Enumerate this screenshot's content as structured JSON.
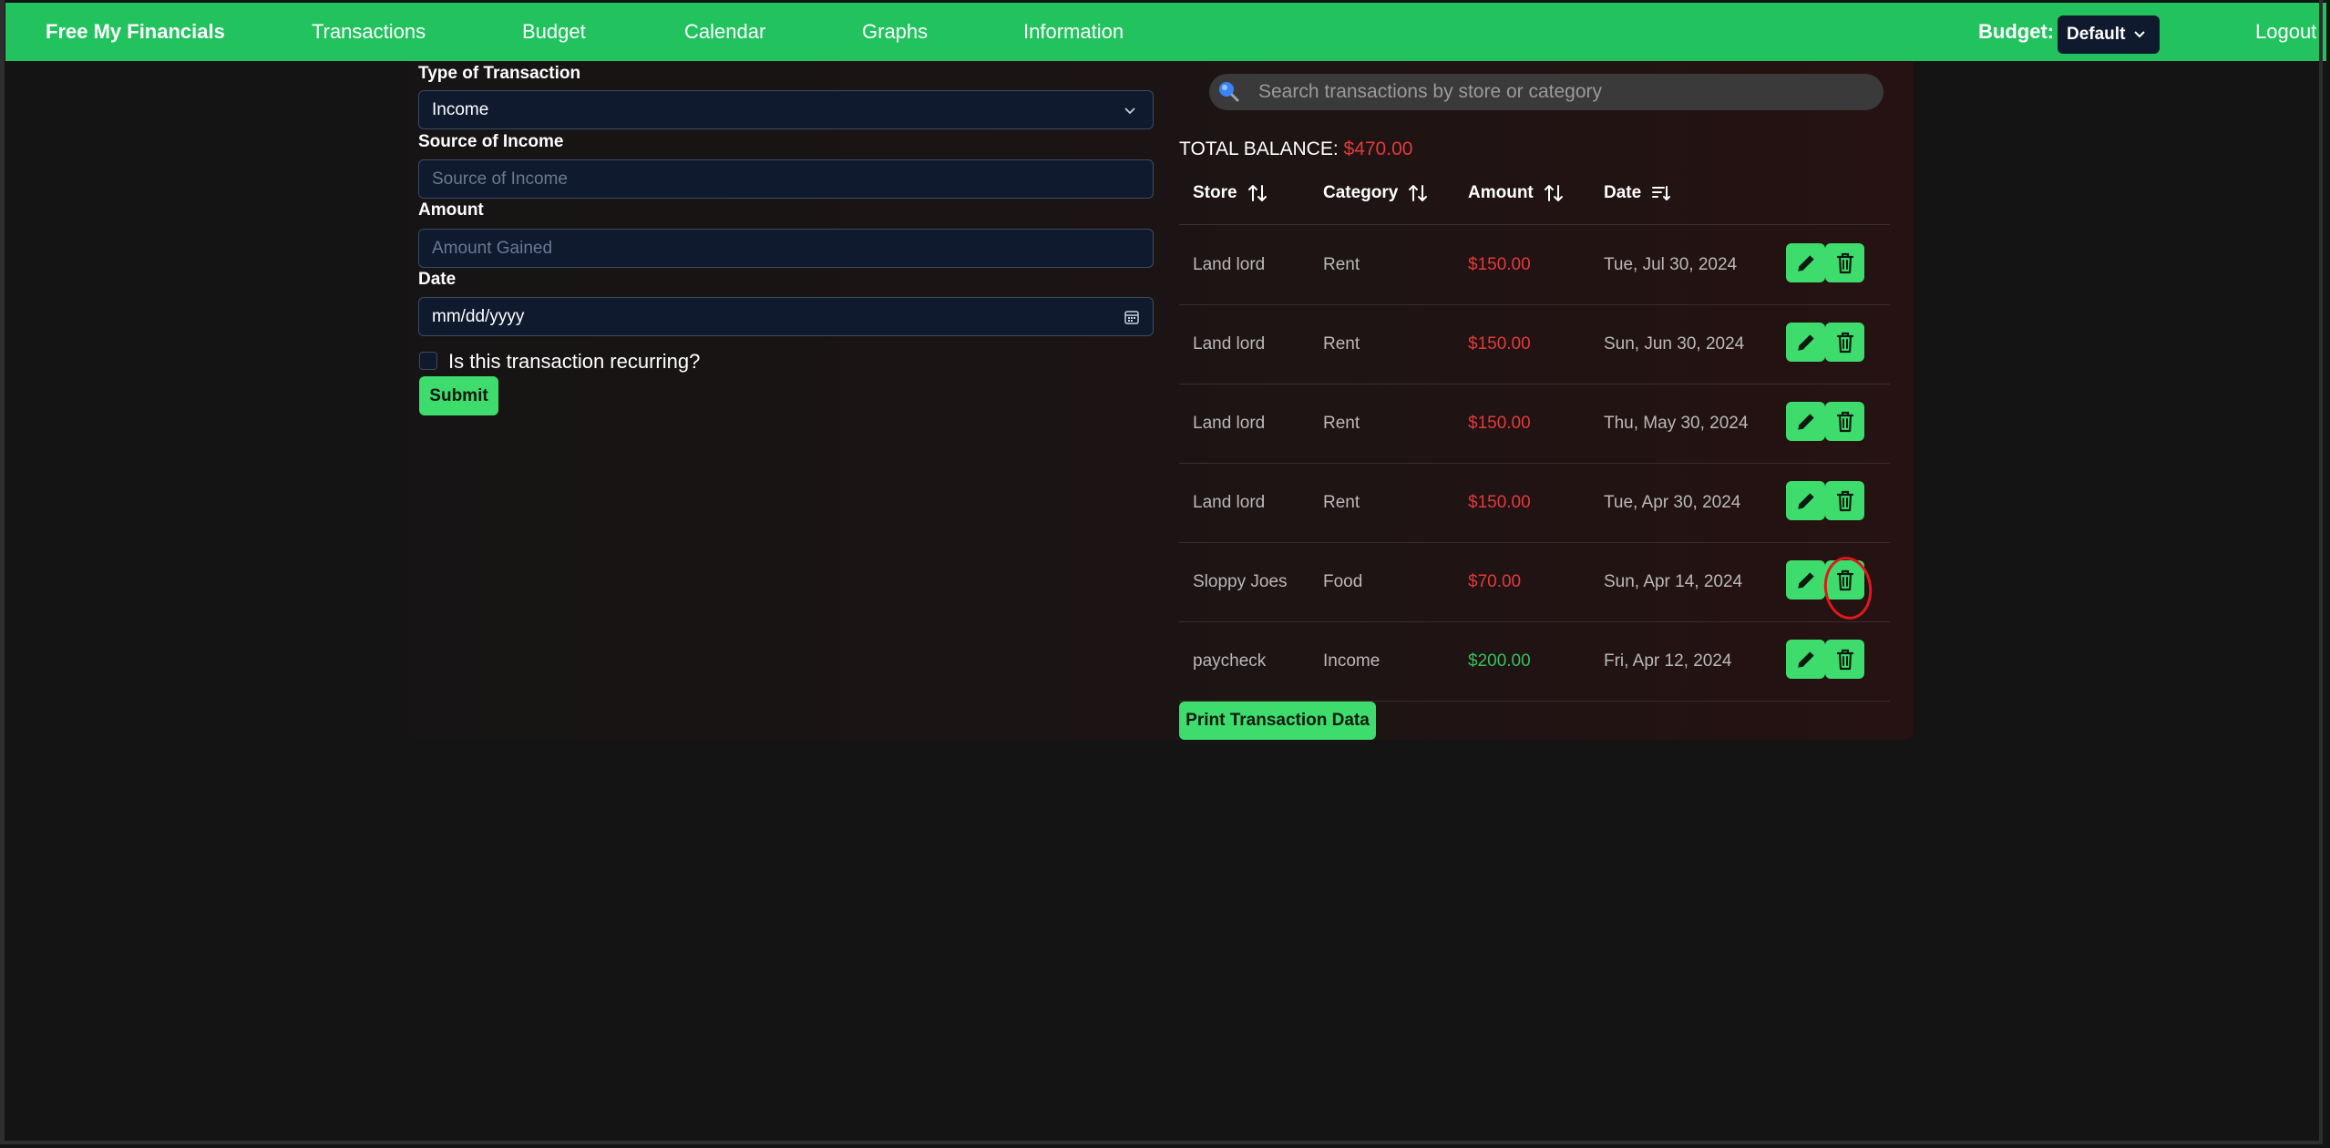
{
  "nav": {
    "brand": "Free My Financials",
    "links": [
      "Transactions",
      "Budget",
      "Calendar",
      "Graphs",
      "Information"
    ],
    "budget_label": "Budget:",
    "budget_value": "Default",
    "logout": "Logout"
  },
  "form": {
    "type_label": "Type of Transaction",
    "type_value": "Income",
    "source_label": "Source of Income",
    "source_placeholder": "Source of Income",
    "amount_label": "Amount",
    "amount_placeholder": "Amount Gained",
    "date_label": "Date",
    "date_placeholder": "mm/dd/yyyy",
    "recurring_label": "Is this transaction recurring?",
    "submit": "Submit"
  },
  "search": {
    "placeholder": "Search transactions by store or category"
  },
  "balance": {
    "label": "TOTAL BALANCE:",
    "value": "$470.00"
  },
  "table": {
    "headers": [
      "Store",
      "Category",
      "Amount",
      "Date"
    ],
    "rows": [
      {
        "store": "Land lord",
        "category": "Rent",
        "amount": "$150.00",
        "date": "Tue, Jul 30, 2024",
        "type": "expense"
      },
      {
        "store": "Land lord",
        "category": "Rent",
        "amount": "$150.00",
        "date": "Sun, Jun 30, 2024",
        "type": "expense"
      },
      {
        "store": "Land lord",
        "category": "Rent",
        "amount": "$150.00",
        "date": "Thu, May 30, 2024",
        "type": "expense"
      },
      {
        "store": "Land lord",
        "category": "Rent",
        "amount": "$150.00",
        "date": "Tue, Apr 30, 2024",
        "type": "expense"
      },
      {
        "store": "Sloppy Joes",
        "category": "Food",
        "amount": "$70.00",
        "date": "Sun, Apr 14, 2024",
        "type": "expense"
      },
      {
        "store": "paycheck",
        "category": "Income",
        "amount": "$200.00",
        "date": "Fri, Apr 12, 2024",
        "type": "income"
      }
    ],
    "icons": {
      "edit": "pencil-icon",
      "delete": "trash-icon"
    }
  },
  "print_button": "Print Transaction Data",
  "colors": {
    "nav_bg": "#22c35e",
    "button": "#3ddc6c",
    "expense": "#e23a3a",
    "income": "#33c15a",
    "annotation": "#e0181d"
  }
}
